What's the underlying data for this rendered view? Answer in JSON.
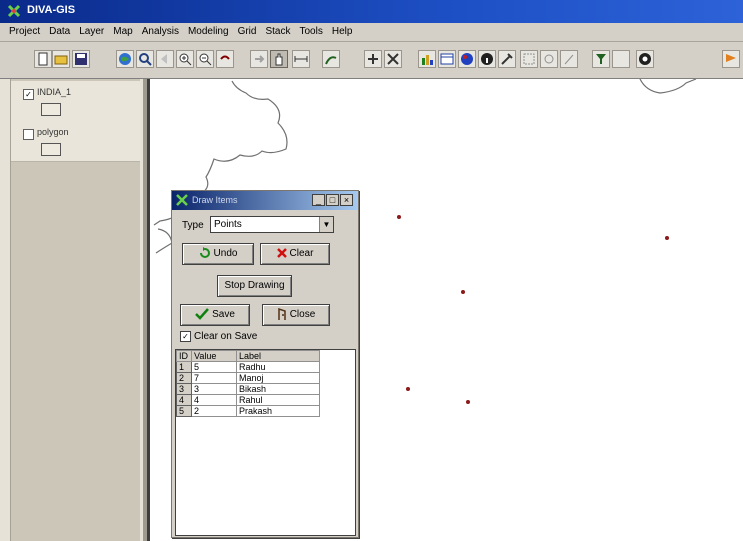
{
  "app": {
    "title": "DIVA-GIS"
  },
  "menu": [
    "Project",
    "Data",
    "Layer",
    "Map",
    "Analysis",
    "Modeling",
    "Grid",
    "Stack",
    "Tools",
    "Help"
  ],
  "toolbar": {
    "buttons": [
      "new",
      "open",
      "save",
      "globe",
      "zoom",
      "zoom-back",
      "zoom-in",
      "zoom-out",
      "undo",
      "redo",
      "pan",
      "measure",
      "bird",
      "add-point",
      "delete",
      "bars",
      "table",
      "palette",
      "info",
      "tools",
      "select",
      "refresh",
      "bird2",
      "filter",
      "blank",
      "target",
      "flag"
    ]
  },
  "layers": [
    {
      "name": "INDIA_1",
      "checked": true
    },
    {
      "name": "polygon",
      "checked": false
    }
  ],
  "map": {
    "point_count": 5
  },
  "dialog": {
    "title": "Draw Items",
    "type_label": "Type",
    "type_value": "Points",
    "undo_label": "Undo",
    "clear_label": "Clear",
    "stop_label": "Stop Drawing",
    "save_label": "Save",
    "close_label": "Close",
    "clear_on_save_label": "Clear on Save",
    "clear_on_save_checked": true,
    "columns": [
      "ID",
      "Value",
      "Label"
    ],
    "rows": [
      {
        "id": "1",
        "value": "5",
        "label": "Radhu"
      },
      {
        "id": "2",
        "value": "7",
        "label": "Manoj"
      },
      {
        "id": "3",
        "value": "3",
        "label": "Bikash"
      },
      {
        "id": "4",
        "value": "4",
        "label": "Rahul"
      },
      {
        "id": "5",
        "value": "2",
        "label": "Prakash"
      }
    ]
  },
  "colors": {
    "titlebar": "#1d4fc4",
    "point": "#8b1a1a",
    "panel": "#d4d0c8"
  }
}
